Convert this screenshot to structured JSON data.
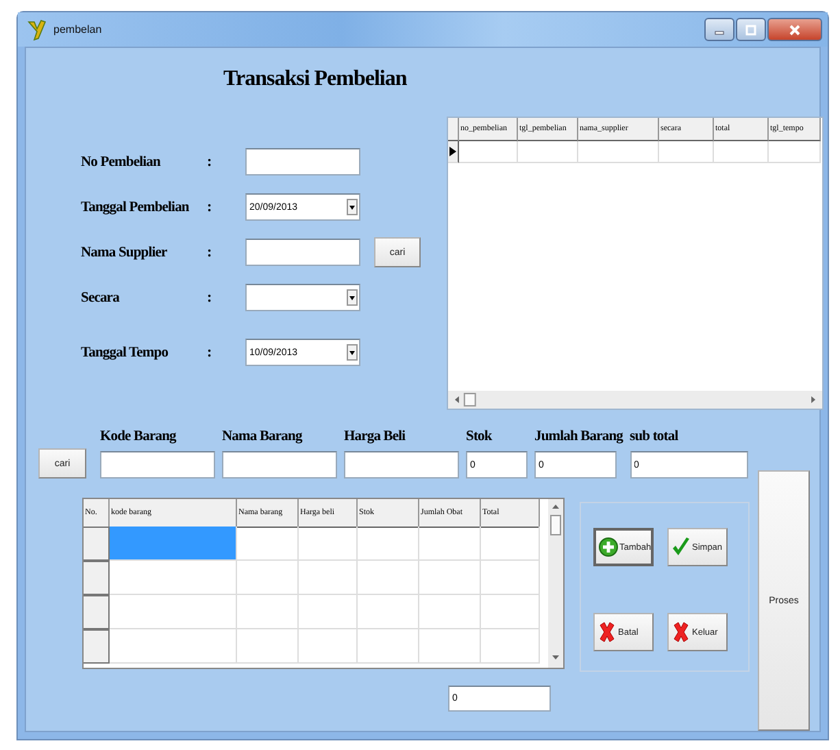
{
  "window": {
    "title": "pembelan"
  },
  "heading": "Transaksi Pembelian",
  "form": {
    "fields": [
      {
        "label": "No Pembelian",
        "separator": ":",
        "kind": "text"
      },
      {
        "label": "Tanggal Pembelian",
        "separator": ":",
        "kind": "dropdown",
        "value": "20/09/2013"
      },
      {
        "label": "Nama Supplier",
        "separator": ":",
        "kind": "text",
        "button": "cari"
      },
      {
        "label": "Secara",
        "separator": ":",
        "kind": "dropdown"
      },
      {
        "label": "Tanggal Tempo",
        "separator": ":",
        "kind": "dropdown",
        "value": "10/09/2013"
      }
    ]
  },
  "purchase_table": {
    "columns": [
      "no_pembelian",
      "tgl_pembelian",
      "nama_supplier",
      "secara",
      "total",
      "tgl_tempo"
    ],
    "rows": [
      {
        "current": true
      }
    ]
  },
  "item_entry": {
    "search_button": "cari",
    "fields": [
      {
        "label": "Kode Barang"
      },
      {
        "label": "Nama Barang"
      },
      {
        "label": "Harga Beli"
      },
      {
        "label": "Stok",
        "value": "0"
      },
      {
        "label": "Jumlah Barang",
        "value": "0"
      },
      {
        "label": "sub total",
        "value": "0"
      }
    ]
  },
  "items_table": {
    "columns": [
      "No.",
      "kode barang",
      "Nama barang",
      "Harga beli",
      "Stok",
      "Jumlah Obat",
      "Total"
    ],
    "rows": [
      {
        "selected": true
      },
      {
        "selected": false
      },
      {
        "selected": false
      },
      {
        "selected": false
      }
    ]
  },
  "total": {
    "value": "0"
  },
  "actions": [
    {
      "label": "Tambah",
      "kind": "add",
      "focused": true
    },
    {
      "label": "Simpan",
      "kind": "save",
      "focused": false
    },
    {
      "label": "Batal",
      "kind": "cancel",
      "focused": false
    },
    {
      "label": "Keluar",
      "kind": "exit",
      "focused": false
    }
  ],
  "process_button": "Proses"
}
